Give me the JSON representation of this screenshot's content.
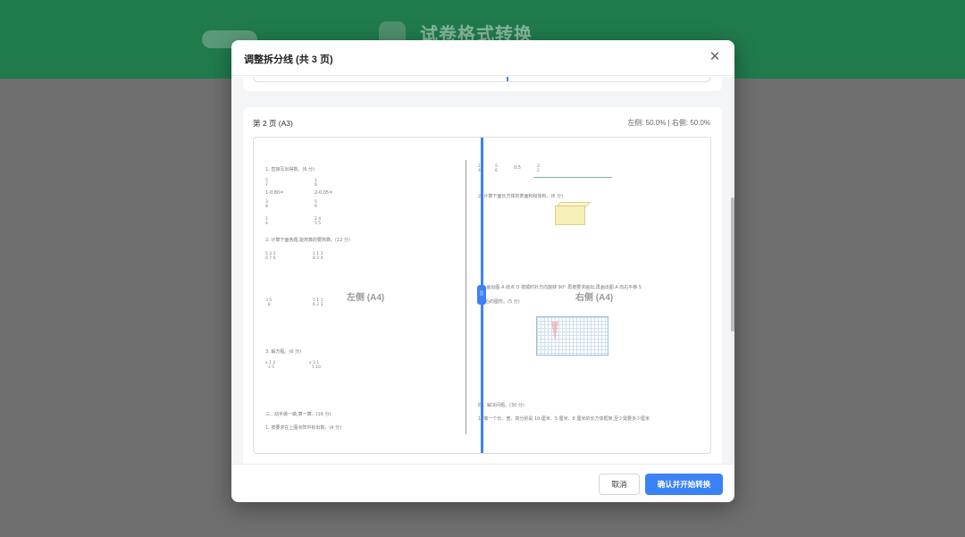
{
  "background": {
    "app_title": "试卷格式转换",
    "pill_label": "",
    "header_color": "#1f7a4c"
  },
  "modal": {
    "title": "调整拆分线 (共 3 页)",
    "close_icon": "close-icon",
    "pages": [
      {
        "label": "第 2 页 (A3)",
        "ratio_text": "左侧: 50.0% | 右侧: 50.0%",
        "left_label": "左侧 (A4)",
        "right_label": "右侧 (A4)",
        "left_percent": 50.0,
        "right_percent": 50.0,
        "split_handle_icon": "drag-handle-icon",
        "left_content": {
          "q1": "1. 直接写出得数。(6 分)",
          "q1_a": "1-0.80=",
          "q1_b": "2-0.05=",
          "q2": "2. 计算下面各题,能简算的要简算。(12 分)",
          "q3": "3. 解方程。(6 分)",
          "q4": "三、动手做一做,算一算。(16 分)",
          "q5": "1. 按要求在上图点阵中标出数。(4 分)"
        },
        "right_content": {
          "numline_label": "0.5",
          "q6": "2. 计算下面长方体的表面积和体积。(6 分)",
          "q7": "3. 画出图 A 绕点 O 按顺时针方向旋转 90° 再按要求画出,再画出图 A 向右平移 5",
          "q7b": "格后的图形。(5 分)",
          "q8": "四、解决问题。(30 分)",
          "q9": "1. 做一个长、宽、高分别是 10 厘米、5 厘米、8 厘米的长方体框架,至少需要多少厘米"
        }
      }
    ],
    "footer": {
      "cancel_label": "取消",
      "confirm_label": "确认并开始转换"
    },
    "accent_color": "#3b82f6"
  }
}
